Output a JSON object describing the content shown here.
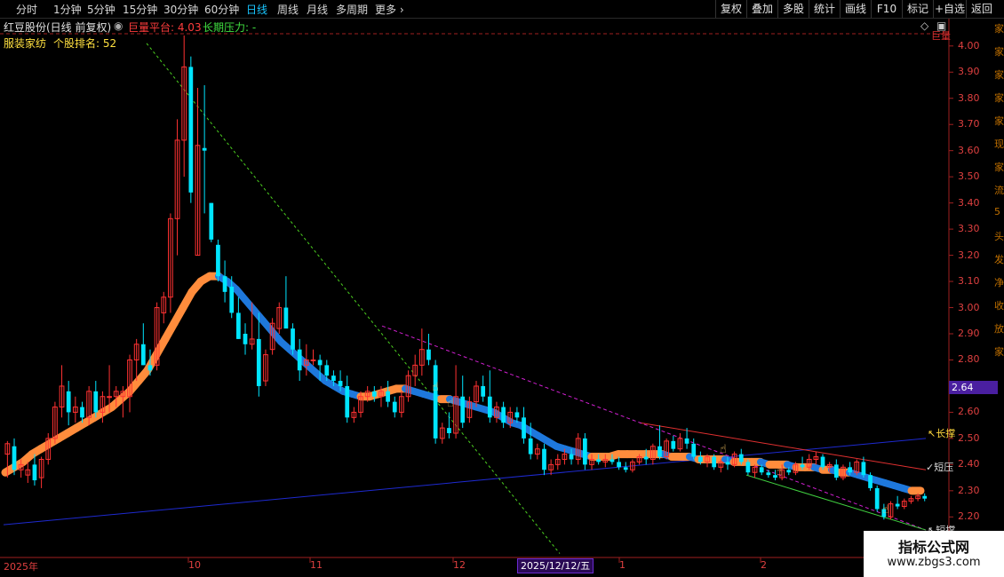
{
  "toolbar": {
    "periods": [
      "分时",
      "1分钟",
      "5分钟",
      "15分钟",
      "30分钟",
      "60分钟",
      "日线",
      "周线",
      "月线",
      "多周期",
      "更多"
    ],
    "active_period": "日线",
    "right_buttons": [
      "复权",
      "叠加",
      "多股",
      "统计",
      "画线",
      "F10",
      "标记",
      "+自选",
      "返回"
    ]
  },
  "info": {
    "stock_name": "红豆股份(日线 前复权)",
    "indicator_label": "巨量平台: 4.03",
    "pressure_label": "长期压力: -",
    "sector_label": "服装家纺",
    "rank_label": "个股排名: 52"
  },
  "colors": {
    "up": "#ff3232",
    "down": "#00e5ff",
    "axis": "#e04040",
    "ma_up": "#ff8c3c",
    "ma_down": "#1e78dc",
    "blue_line": "#1e2ad0",
    "red_line": "#e03030",
    "green_dashed": "#4cd020",
    "magenta_dashed": "#d020d0",
    "green_line": "#40d040"
  },
  "price_tag": "2.64",
  "right_labels": {
    "long_support": "长撑",
    "short_pressure": "短压",
    "short_support": "短撑",
    "corner": "巨量"
  },
  "watermark": {
    "title": "指标公式网",
    "url": "www.zbgs3.com"
  },
  "right_side_text": [
    "家",
    "家",
    "家",
    "家",
    "家",
    "现",
    "家",
    "流",
    "5",
    "头",
    "发",
    "净",
    "收",
    "放",
    "家"
  ],
  "chart_data": {
    "type": "candlestick",
    "y_ticks": [
      "4.00",
      "3.90",
      "3.80",
      "3.70",
      "3.60",
      "3.50",
      "3.40",
      "3.30",
      "3.20",
      "3.10",
      "3.00",
      "2.90",
      "2.80",
      "2.70",
      "2.60",
      "2.50",
      "2.40",
      "2.30",
      "2.20"
    ],
    "ylim": [
      2.14,
      4.04
    ],
    "x_labels": [
      "2025年",
      "10",
      "11",
      "12",
      "2025/12/12/五",
      "1",
      "2"
    ],
    "highlighted_date": "2025/12/12/五",
    "candles": [
      {
        "o": 2.44,
        "h": 2.49,
        "l": 2.35,
        "c": 2.48
      },
      {
        "o": 2.47,
        "h": 2.5,
        "l": 2.36,
        "c": 2.38
      },
      {
        "o": 2.38,
        "h": 2.42,
        "l": 2.35,
        "c": 2.4
      },
      {
        "o": 2.36,
        "h": 2.41,
        "l": 2.33,
        "c": 2.38
      },
      {
        "o": 2.4,
        "h": 2.44,
        "l": 2.32,
        "c": 2.34
      },
      {
        "o": 2.35,
        "h": 2.43,
        "l": 2.31,
        "c": 2.42
      },
      {
        "o": 2.42,
        "h": 2.52,
        "l": 2.4,
        "c": 2.5
      },
      {
        "o": 2.5,
        "h": 2.64,
        "l": 2.48,
        "c": 2.62
      },
      {
        "o": 2.62,
        "h": 2.78,
        "l": 2.58,
        "c": 2.7
      },
      {
        "o": 2.68,
        "h": 2.72,
        "l": 2.55,
        "c": 2.6
      },
      {
        "o": 2.6,
        "h": 2.66,
        "l": 2.56,
        "c": 2.62
      },
      {
        "o": 2.62,
        "h": 2.64,
        "l": 2.56,
        "c": 2.58
      },
      {
        "o": 2.58,
        "h": 2.7,
        "l": 2.55,
        "c": 2.68
      },
      {
        "o": 2.68,
        "h": 2.72,
        "l": 2.58,
        "c": 2.6
      },
      {
        "o": 2.6,
        "h": 2.68,
        "l": 2.56,
        "c": 2.66
      },
      {
        "o": 2.66,
        "h": 2.78,
        "l": 2.6,
        "c": 2.66
      },
      {
        "o": 2.66,
        "h": 2.7,
        "l": 2.62,
        "c": 2.68
      },
      {
        "o": 2.66,
        "h": 2.7,
        "l": 2.58,
        "c": 2.68
      },
      {
        "o": 2.66,
        "h": 2.82,
        "l": 2.6,
        "c": 2.8
      },
      {
        "o": 2.8,
        "h": 2.88,
        "l": 2.72,
        "c": 2.86
      },
      {
        "o": 2.86,
        "h": 2.94,
        "l": 2.78,
        "c": 2.78
      },
      {
        "o": 2.78,
        "h": 2.84,
        "l": 2.74,
        "c": 2.76
      },
      {
        "o": 2.78,
        "h": 3.02,
        "l": 2.76,
        "c": 3.0
      },
      {
        "o": 2.98,
        "h": 3.06,
        "l": 2.94,
        "c": 3.04
      },
      {
        "o": 3.04,
        "h": 3.36,
        "l": 2.98,
        "c": 3.34
      },
      {
        "o": 3.34,
        "h": 3.72,
        "l": 3.2,
        "c": 3.64
      },
      {
        "o": 3.64,
        "h": 4.04,
        "l": 3.5,
        "c": 3.92
      },
      {
        "o": 3.92,
        "h": 3.96,
        "l": 3.4,
        "c": 3.44
      },
      {
        "o": 3.2,
        "h": 3.84,
        "l": 3.2,
        "c": 3.62
      },
      {
        "o": 3.61,
        "h": 3.85,
        "l": 3.36,
        "c": 3.6
      },
      {
        "o": 3.4,
        "h": 3.4,
        "l": 3.25,
        "c": 3.26
      },
      {
        "o": 3.24,
        "h": 3.26,
        "l": 3.1,
        "c": 3.12
      },
      {
        "o": 3.12,
        "h": 3.18,
        "l": 3.02,
        "c": 3.06
      },
      {
        "o": 3.08,
        "h": 3.12,
        "l": 2.96,
        "c": 2.98
      },
      {
        "o": 2.98,
        "h": 3.04,
        "l": 2.88,
        "c": 2.88
      },
      {
        "o": 2.9,
        "h": 2.94,
        "l": 2.82,
        "c": 2.86
      },
      {
        "o": 2.86,
        "h": 3.02,
        "l": 2.84,
        "c": 2.88
      },
      {
        "o": 2.88,
        "h": 2.98,
        "l": 2.66,
        "c": 2.7
      },
      {
        "o": 2.72,
        "h": 2.84,
        "l": 2.7,
        "c": 2.82
      },
      {
        "o": 2.84,
        "h": 2.96,
        "l": 2.82,
        "c": 2.94
      },
      {
        "o": 2.92,
        "h": 3.02,
        "l": 2.9,
        "c": 3.0
      },
      {
        "o": 3.0,
        "h": 3.12,
        "l": 2.94,
        "c": 2.92
      },
      {
        "o": 2.92,
        "h": 2.94,
        "l": 2.82,
        "c": 2.84
      },
      {
        "o": 2.84,
        "h": 2.88,
        "l": 2.72,
        "c": 2.76
      },
      {
        "o": 2.78,
        "h": 2.86,
        "l": 2.74,
        "c": 2.8
      },
      {
        "o": 2.8,
        "h": 2.84,
        "l": 2.78,
        "c": 2.8
      },
      {
        "o": 2.8,
        "h": 2.82,
        "l": 2.72,
        "c": 2.78
      },
      {
        "o": 2.78,
        "h": 2.8,
        "l": 2.72,
        "c": 2.74
      },
      {
        "o": 2.74,
        "h": 2.76,
        "l": 2.7,
        "c": 2.72
      },
      {
        "o": 2.72,
        "h": 2.76,
        "l": 2.68,
        "c": 2.7
      },
      {
        "o": 2.7,
        "h": 2.74,
        "l": 2.56,
        "c": 2.58
      },
      {
        "o": 2.58,
        "h": 2.62,
        "l": 2.56,
        "c": 2.6
      },
      {
        "o": 2.6,
        "h": 2.68,
        "l": 2.58,
        "c": 2.66
      },
      {
        "o": 2.66,
        "h": 2.7,
        "l": 2.64,
        "c": 2.68
      },
      {
        "o": 2.68,
        "h": 2.7,
        "l": 2.64,
        "c": 2.66
      },
      {
        "o": 2.66,
        "h": 2.7,
        "l": 2.62,
        "c": 2.68
      },
      {
        "o": 2.68,
        "h": 2.72,
        "l": 2.62,
        "c": 2.64
      },
      {
        "o": 2.64,
        "h": 2.66,
        "l": 2.58,
        "c": 2.6
      },
      {
        "o": 2.6,
        "h": 2.68,
        "l": 2.58,
        "c": 2.66
      },
      {
        "o": 2.66,
        "h": 2.76,
        "l": 2.64,
        "c": 2.74
      },
      {
        "o": 2.74,
        "h": 2.82,
        "l": 2.7,
        "c": 2.78
      },
      {
        "o": 2.78,
        "h": 2.92,
        "l": 2.74,
        "c": 2.84
      },
      {
        "o": 2.84,
        "h": 2.9,
        "l": 2.78,
        "c": 2.8
      },
      {
        "o": 2.78,
        "h": 2.8,
        "l": 2.48,
        "c": 2.5
      },
      {
        "o": 2.5,
        "h": 2.56,
        "l": 2.48,
        "c": 2.54
      },
      {
        "o": 2.54,
        "h": 2.6,
        "l": 2.5,
        "c": 2.52
      },
      {
        "o": 2.52,
        "h": 2.78,
        "l": 2.5,
        "c": 2.66
      },
      {
        "o": 2.66,
        "h": 2.74,
        "l": 2.54,
        "c": 2.56
      },
      {
        "o": 2.58,
        "h": 2.66,
        "l": 2.56,
        "c": 2.64
      },
      {
        "o": 2.64,
        "h": 2.72,
        "l": 2.62,
        "c": 2.7
      },
      {
        "o": 2.7,
        "h": 2.74,
        "l": 2.64,
        "c": 2.66
      },
      {
        "o": 2.66,
        "h": 2.76,
        "l": 2.56,
        "c": 2.58
      },
      {
        "o": 2.58,
        "h": 2.64,
        "l": 2.56,
        "c": 2.62
      },
      {
        "o": 2.62,
        "h": 2.64,
        "l": 2.54,
        "c": 2.56
      },
      {
        "o": 2.56,
        "h": 2.62,
        "l": 2.54,
        "c": 2.6
      },
      {
        "o": 2.6,
        "h": 2.62,
        "l": 2.56,
        "c": 2.58
      },
      {
        "o": 2.58,
        "h": 2.62,
        "l": 2.48,
        "c": 2.5
      },
      {
        "o": 2.5,
        "h": 2.56,
        "l": 2.42,
        "c": 2.44
      },
      {
        "o": 2.44,
        "h": 2.48,
        "l": 2.42,
        "c": 2.46
      },
      {
        "o": 2.46,
        "h": 2.48,
        "l": 2.36,
        "c": 2.38
      },
      {
        "o": 2.38,
        "h": 2.42,
        "l": 2.36,
        "c": 2.4
      },
      {
        "o": 2.4,
        "h": 2.44,
        "l": 2.38,
        "c": 2.42
      },
      {
        "o": 2.42,
        "h": 2.46,
        "l": 2.4,
        "c": 2.44
      },
      {
        "o": 2.44,
        "h": 2.46,
        "l": 2.4,
        "c": 2.42
      },
      {
        "o": 2.42,
        "h": 2.52,
        "l": 2.4,
        "c": 2.5
      },
      {
        "o": 2.5,
        "h": 2.52,
        "l": 2.38,
        "c": 2.4
      },
      {
        "o": 2.4,
        "h": 2.44,
        "l": 2.38,
        "c": 2.42
      },
      {
        "o": 2.42,
        "h": 2.44,
        "l": 2.4,
        "c": 2.41
      },
      {
        "o": 2.41,
        "h": 2.44,
        "l": 2.39,
        "c": 2.42
      },
      {
        "o": 2.42,
        "h": 2.44,
        "l": 2.4,
        "c": 2.41
      },
      {
        "o": 2.41,
        "h": 2.43,
        "l": 2.38,
        "c": 2.39
      },
      {
        "o": 2.39,
        "h": 2.41,
        "l": 2.37,
        "c": 2.38
      },
      {
        "o": 2.38,
        "h": 2.42,
        "l": 2.37,
        "c": 2.41
      },
      {
        "o": 2.41,
        "h": 2.44,
        "l": 2.4,
        "c": 2.43
      },
      {
        "o": 2.43,
        "h": 2.46,
        "l": 2.4,
        "c": 2.42
      },
      {
        "o": 2.42,
        "h": 2.48,
        "l": 2.4,
        "c": 2.47
      },
      {
        "o": 2.47,
        "h": 2.55,
        "l": 2.42,
        "c": 2.43
      },
      {
        "o": 2.43,
        "h": 2.5,
        "l": 2.42,
        "c": 2.49
      },
      {
        "o": 2.49,
        "h": 2.51,
        "l": 2.45,
        "c": 2.46
      },
      {
        "o": 2.46,
        "h": 2.52,
        "l": 2.45,
        "c": 2.5
      },
      {
        "o": 2.5,
        "h": 2.54,
        "l": 2.46,
        "c": 2.48
      },
      {
        "o": 2.48,
        "h": 2.5,
        "l": 2.42,
        "c": 2.43
      },
      {
        "o": 2.43,
        "h": 2.45,
        "l": 2.4,
        "c": 2.41
      },
      {
        "o": 2.41,
        "h": 2.44,
        "l": 2.39,
        "c": 2.43
      },
      {
        "o": 2.43,
        "h": 2.44,
        "l": 2.38,
        "c": 2.39
      },
      {
        "o": 2.39,
        "h": 2.42,
        "l": 2.37,
        "c": 2.41
      },
      {
        "o": 2.41,
        "h": 2.43,
        "l": 2.38,
        "c": 2.4
      },
      {
        "o": 2.4,
        "h": 2.45,
        "l": 2.39,
        "c": 2.44
      },
      {
        "o": 2.44,
        "h": 2.46,
        "l": 2.4,
        "c": 2.41
      },
      {
        "o": 2.41,
        "h": 2.42,
        "l": 2.36,
        "c": 2.37
      },
      {
        "o": 2.37,
        "h": 2.4,
        "l": 2.35,
        "c": 2.39
      },
      {
        "o": 2.39,
        "h": 2.4,
        "l": 2.36,
        "c": 2.37
      },
      {
        "o": 2.37,
        "h": 2.38,
        "l": 2.35,
        "c": 2.36
      },
      {
        "o": 2.36,
        "h": 2.38,
        "l": 2.34,
        "c": 2.35
      },
      {
        "o": 2.35,
        "h": 2.4,
        "l": 2.34,
        "c": 2.38
      },
      {
        "o": 2.38,
        "h": 2.39,
        "l": 2.36,
        "c": 2.37
      },
      {
        "o": 2.37,
        "h": 2.41,
        "l": 2.36,
        "c": 2.4
      },
      {
        "o": 2.4,
        "h": 2.43,
        "l": 2.38,
        "c": 2.39
      },
      {
        "o": 2.39,
        "h": 2.44,
        "l": 2.38,
        "c": 2.42
      },
      {
        "o": 2.42,
        "h": 2.45,
        "l": 2.4,
        "c": 2.43
      },
      {
        "o": 2.43,
        "h": 2.44,
        "l": 2.38,
        "c": 2.39
      },
      {
        "o": 2.39,
        "h": 2.41,
        "l": 2.37,
        "c": 2.4
      },
      {
        "o": 2.4,
        "h": 2.42,
        "l": 2.34,
        "c": 2.35
      },
      {
        "o": 2.35,
        "h": 2.4,
        "l": 2.34,
        "c": 2.39
      },
      {
        "o": 2.39,
        "h": 2.41,
        "l": 2.36,
        "c": 2.37
      },
      {
        "o": 2.37,
        "h": 2.42,
        "l": 2.36,
        "c": 2.41
      },
      {
        "o": 2.41,
        "h": 2.43,
        "l": 2.35,
        "c": 2.36
      },
      {
        "o": 2.36,
        "h": 2.37,
        "l": 2.3,
        "c": 2.31
      },
      {
        "o": 2.31,
        "h": 2.32,
        "l": 2.22,
        "c": 2.23
      },
      {
        "o": 2.23,
        "h": 2.25,
        "l": 2.19,
        "c": 2.2
      },
      {
        "o": 2.2,
        "h": 2.26,
        "l": 2.19,
        "c": 2.25
      },
      {
        "o": 2.25,
        "h": 2.28,
        "l": 2.23,
        "c": 2.24
      },
      {
        "o": 2.24,
        "h": 2.27,
        "l": 2.23,
        "c": 2.26
      },
      {
        "o": 2.26,
        "h": 2.28,
        "l": 2.25,
        "c": 2.27
      },
      {
        "o": 2.27,
        "h": 2.29,
        "l": 2.26,
        "c": 2.28
      },
      {
        "o": 2.28,
        "h": 2.29,
        "l": 2.26,
        "c": 2.27
      }
    ],
    "moving_average": [
      2.37,
      2.39,
      2.41,
      2.44,
      2.46,
      2.48,
      2.5,
      2.52,
      2.54,
      2.56,
      2.58,
      2.6,
      2.62,
      2.65,
      2.68,
      2.72,
      2.76,
      2.82,
      2.88,
      2.94,
      3.0,
      3.06,
      3.1,
      3.12,
      3.12,
      3.1,
      3.07,
      3.03,
      2.99,
      2.95,
      2.91,
      2.87,
      2.84,
      2.81,
      2.78,
      2.75,
      2.72,
      2.7,
      2.68,
      2.67,
      2.66,
      2.66,
      2.67,
      2.68,
      2.69,
      2.69,
      2.68,
      2.67,
      2.66,
      2.65,
      2.65,
      2.64,
      2.63,
      2.62,
      2.61,
      2.6,
      2.58,
      2.56,
      2.55,
      2.53,
      2.51,
      2.49,
      2.47,
      2.46,
      2.45,
      2.44,
      2.43,
      2.43,
      2.43,
      2.44,
      2.44,
      2.44,
      2.44,
      2.44,
      2.44,
      2.43,
      2.43,
      2.43,
      2.42,
      2.42,
      2.42,
      2.42,
      2.41,
      2.41,
      2.41,
      2.41,
      2.4,
      2.4,
      2.4,
      2.39,
      2.39,
      2.39,
      2.38,
      2.38,
      2.37,
      2.37,
      2.36,
      2.35,
      2.34,
      2.33,
      2.32,
      2.31,
      2.3,
      2.3
    ],
    "trend_lines": {
      "blue_support": [
        [
          2.17,
          0
        ],
        [
          2.5,
          1
        ]
      ],
      "red_pressure": [
        [
          2.56,
          0
        ],
        [
          2.38,
          1
        ]
      ],
      "green_dashed": [
        [
          4.01,
          0
        ],
        [
          2.06,
          1
        ]
      ],
      "magenta_dashed": [
        [
          2.93,
          0
        ],
        [
          2.15,
          1
        ]
      ],
      "green_support": [
        [
          2.36,
          0
        ],
        [
          2.15,
          1
        ]
      ]
    }
  }
}
